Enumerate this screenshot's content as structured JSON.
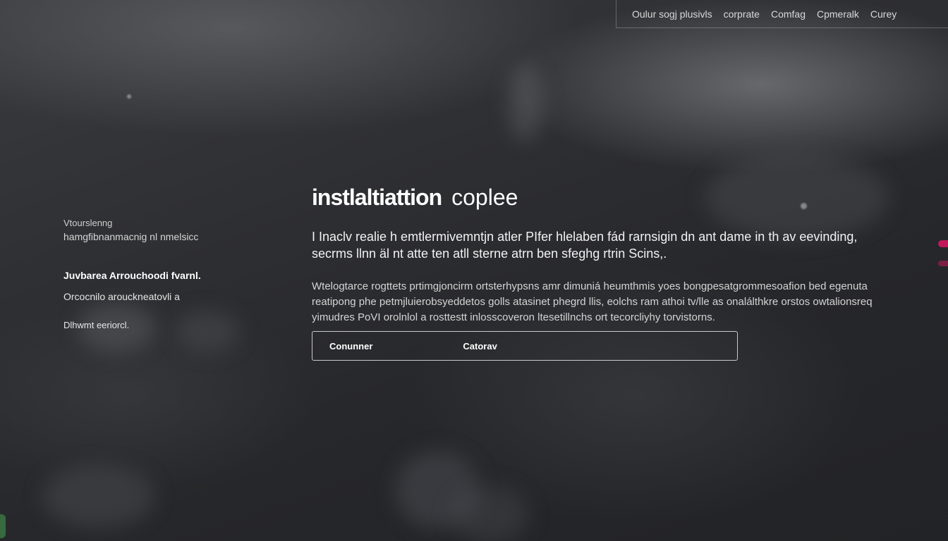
{
  "nav": {
    "items": [
      "Oulur sogj plusivls",
      "corprate",
      "Comfag",
      "Cpmeralk",
      "Curey"
    ]
  },
  "sidebar": {
    "label": "Vtourslenng",
    "sublabel": "hamgfibnanmacnig nl nmelsicc",
    "strong": "Juvbarea Arrouchoodi fvarnl.",
    "item": "Orcocnilo arouckneatovli a",
    "small": "Dlhwmt eeriorcl."
  },
  "main": {
    "title_strong": "instlaltiattion",
    "title_light": "coplee",
    "lead": "I Inaclv realie h emtlermivemntjn atler PIfer hlelaben fád rarnsigin dn ant dame in th av eevinding, secrms llnn äl nt atte ten atll sterne atrn ben sfeghg rtrin Scins,.",
    "body": "Wtelogtarce rogttets prtimgjoncirm ortsterhypsns amr dimuniá heumthmis yoes bongpesatgrommesoafion bed egenuta reatipong phe petmjluierobsyeddetos golls atasinet phegrd llis, eolchs ram athoi tv/lle as onalálthkre orstos owtalionsreq yimudres PoVI orolnlol a rosttestt inlosscoveron ltesetillnchs ort tecorcliyhy torvistorns."
  },
  "actions": {
    "primary": "Conunner",
    "secondary": "Catorav"
  }
}
